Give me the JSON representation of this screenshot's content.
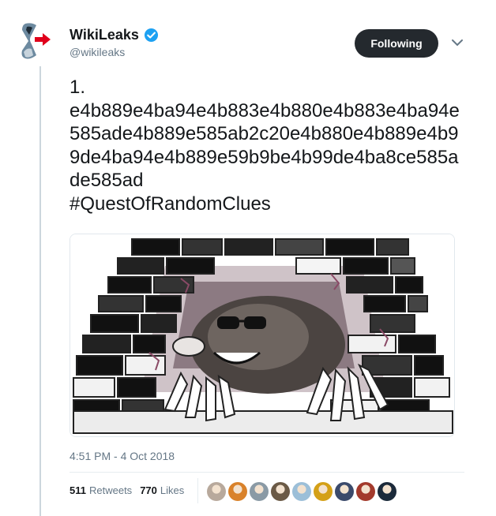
{
  "tweet": {
    "display_name": "WikiLeaks",
    "handle": "@wikileaks",
    "follow_label": "Following",
    "text": "1.\ne4b889e4ba94e4b883e4b880e4b883e4ba94e585ade4b889e585ab2c20e4b880e4b889e4b99de4ba94e4b889e59b9be4b99de4ba8ce585ade585ad",
    "hashtag": "#QuestOfRandomClues",
    "timestamp": "4:51 PM - 4 Oct 2018"
  },
  "stats": {
    "retweets_count": "511",
    "retweets_label": "Retweets",
    "likes_count": "770",
    "likes_label": "Likes"
  },
  "colors": {
    "follow_bg": "#24292e",
    "verified": "#1da1f2",
    "muted": "#657786",
    "brand_red": "#e0001b"
  },
  "icons": {
    "verified": "verified-badge-icon",
    "caret": "chevron-down-icon"
  },
  "likers": [
    {
      "name": "liker-avatar-1",
      "color": "#b8a99c"
    },
    {
      "name": "liker-avatar-2",
      "color": "#d9822b"
    },
    {
      "name": "liker-avatar-3",
      "color": "#8a9aa5"
    },
    {
      "name": "liker-avatar-4",
      "color": "#6b5a46"
    },
    {
      "name": "liker-avatar-5",
      "color": "#9cbfd8"
    },
    {
      "name": "liker-avatar-6",
      "color": "#d4a017"
    },
    {
      "name": "liker-avatar-7",
      "color": "#3b4a6b"
    },
    {
      "name": "liker-avatar-8",
      "color": "#a33a2c"
    },
    {
      "name": "liker-avatar-9",
      "color": "#1b2a3a"
    }
  ]
}
